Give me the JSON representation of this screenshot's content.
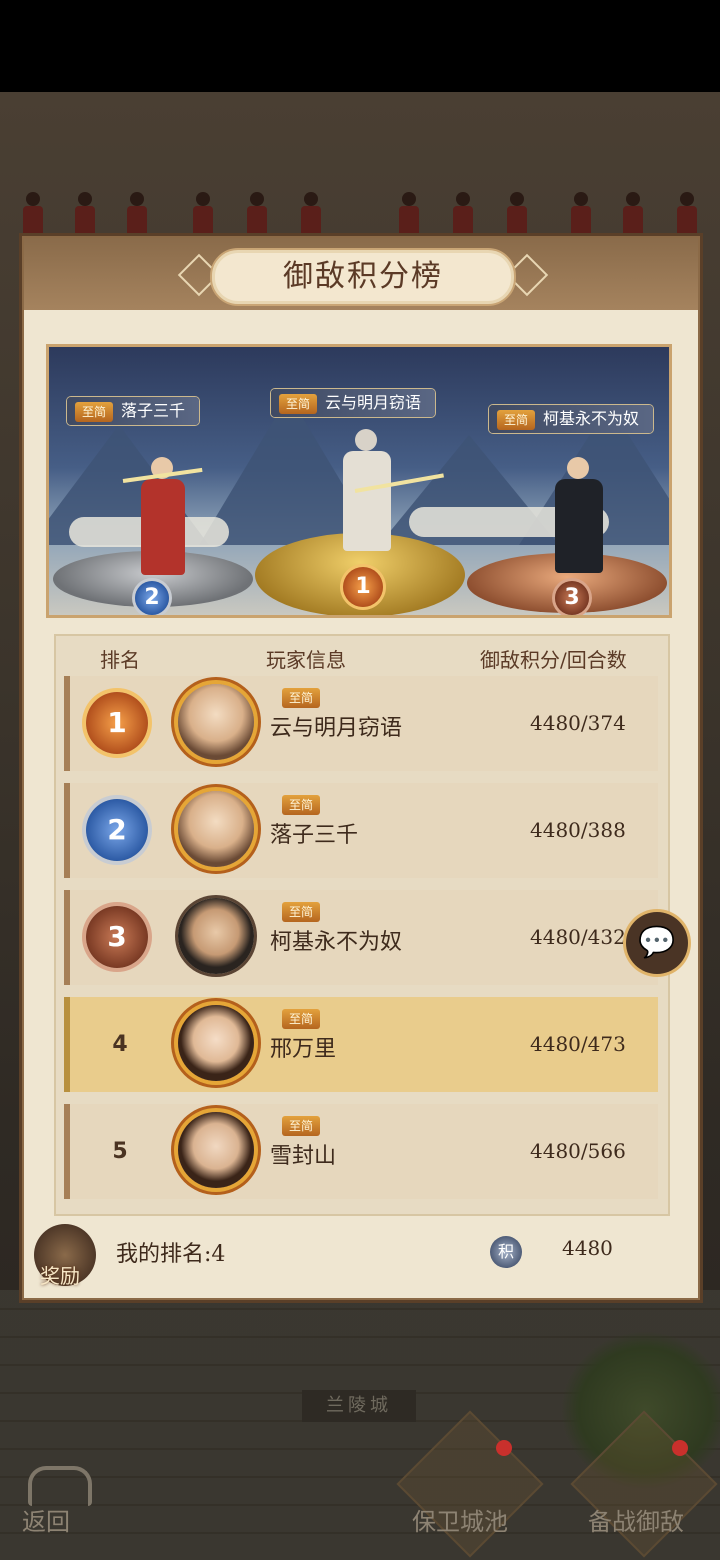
{
  "leaderboard": {
    "title": "御敌积分榜",
    "podium": [
      {
        "rank": "2",
        "badge": "至简",
        "name": "落子三千"
      },
      {
        "rank": "1",
        "badge": "至简",
        "name": "云与明月窃语"
      },
      {
        "rank": "3",
        "badge": "至简",
        "name": "柯基永不为奴"
      }
    ],
    "headers": {
      "rank": "排名",
      "player": "玩家信息",
      "score": "御敌积分/回合数"
    },
    "rows": [
      {
        "rank": "1",
        "badge": "至简",
        "name": "云与明月窃语",
        "score": "4480/374"
      },
      {
        "rank": "2",
        "badge": "至简",
        "name": "落子三千",
        "score": "4480/388"
      },
      {
        "rank": "3",
        "badge": "至简",
        "name": "柯基永不为奴",
        "score": "4480/432"
      },
      {
        "rank": "4",
        "badge": "至简",
        "name": "邢万里",
        "score": "4480/473"
      },
      {
        "rank": "5",
        "badge": "至简",
        "name": "雪封山",
        "score": "4480/566"
      }
    ],
    "footer": {
      "reward_label": "奖励",
      "my_rank": "我的排名:4",
      "score_icon_label": "积",
      "my_score": "4480"
    }
  },
  "chat_icon": "💬",
  "city_label": "兰陵城",
  "bottom_nav": {
    "back_label": "返回",
    "defend_label": "保卫城池",
    "prepare_label": "备战御敌"
  }
}
